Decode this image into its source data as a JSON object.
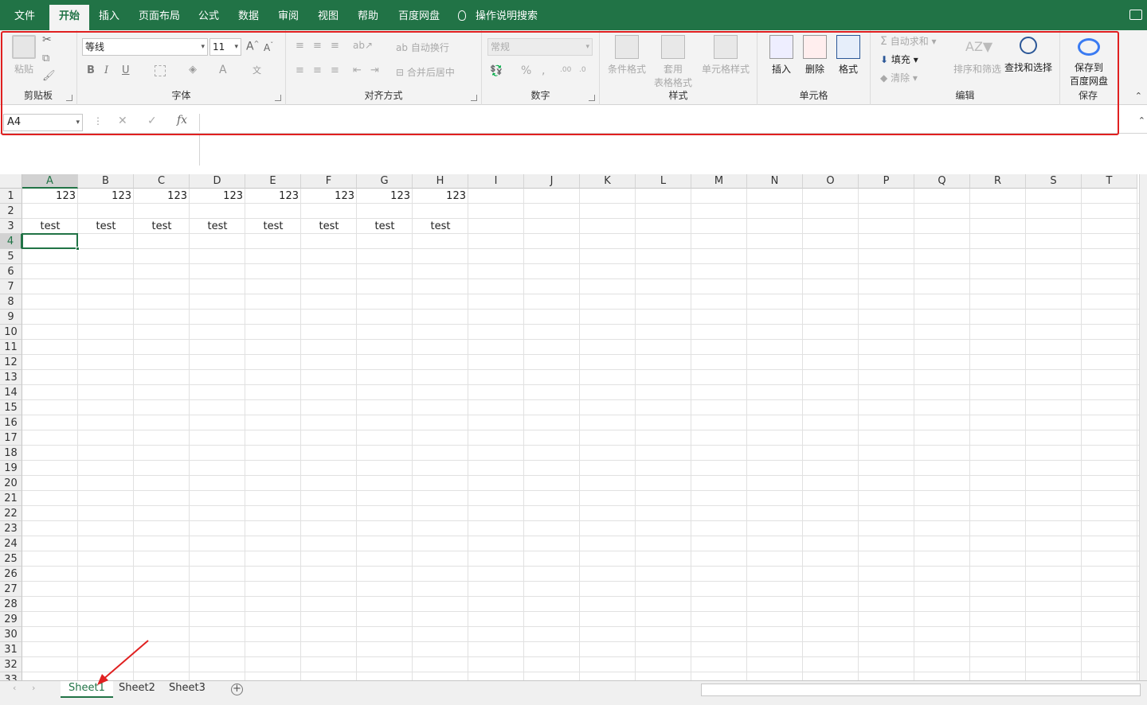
{
  "menu": {
    "items": [
      "文件",
      "开始",
      "插入",
      "页面布局",
      "公式",
      "数据",
      "审阅",
      "视图",
      "帮助",
      "百度网盘"
    ],
    "search": "操作说明搜索"
  },
  "ribbon": {
    "clipboard": {
      "paste": "粘贴",
      "label": "剪贴板"
    },
    "font": {
      "name": "等线",
      "size": "11",
      "label": "字体",
      "bold": "B",
      "italic": "I",
      "underline": "U"
    },
    "alignment": {
      "wrap": "自动换行",
      "merge": "合并后居中",
      "label": "对齐方式"
    },
    "number": {
      "format": "常规",
      "label": "数字",
      "percent": "%"
    },
    "styles": {
      "conditional": "条件格式",
      "table_format": "套用",
      "table_format2": "表格格式",
      "cell_styles": "单元格样式",
      "label": "样式"
    },
    "cells": {
      "insert": "插入",
      "delete": "删除",
      "format": "格式",
      "label": "单元格"
    },
    "editing": {
      "autosum": "自动求和",
      "fill": "填充",
      "clear": "清除",
      "sort": "排序和筛选",
      "find": "查找和选择",
      "label": "编辑"
    },
    "save": {
      "line1": "保存到",
      "line2": "百度网盘",
      "label": "保存"
    }
  },
  "formula_bar": {
    "name_box": "A4",
    "fx": "fx",
    "value": ""
  },
  "columns": [
    "A",
    "B",
    "C",
    "D",
    "E",
    "F",
    "G",
    "H",
    "I",
    "J",
    "K",
    "L",
    "M",
    "N",
    "O",
    "P",
    "Q",
    "R",
    "S",
    "T"
  ],
  "rows": [
    "1",
    "2",
    "3",
    "4",
    "5",
    "6",
    "7",
    "8",
    "9",
    "10",
    "11",
    "12",
    "13",
    "14",
    "15",
    "16",
    "17",
    "18",
    "19",
    "20",
    "21",
    "22",
    "23",
    "24",
    "25",
    "26",
    "27",
    "28",
    "29",
    "30",
    "31",
    "32",
    "33"
  ],
  "data": {
    "row1": [
      "123",
      "123",
      "123",
      "123",
      "123",
      "123",
      "123",
      "123"
    ],
    "row3": [
      "test",
      "test",
      "test",
      "test",
      "test",
      "test",
      "test",
      "test"
    ]
  },
  "selected_cell": "A4",
  "sheets": [
    "Sheet1",
    "Sheet2",
    "Sheet3"
  ],
  "active_sheet": "Sheet1",
  "colors": {
    "accent": "#217346",
    "highlight": "#e02020"
  }
}
